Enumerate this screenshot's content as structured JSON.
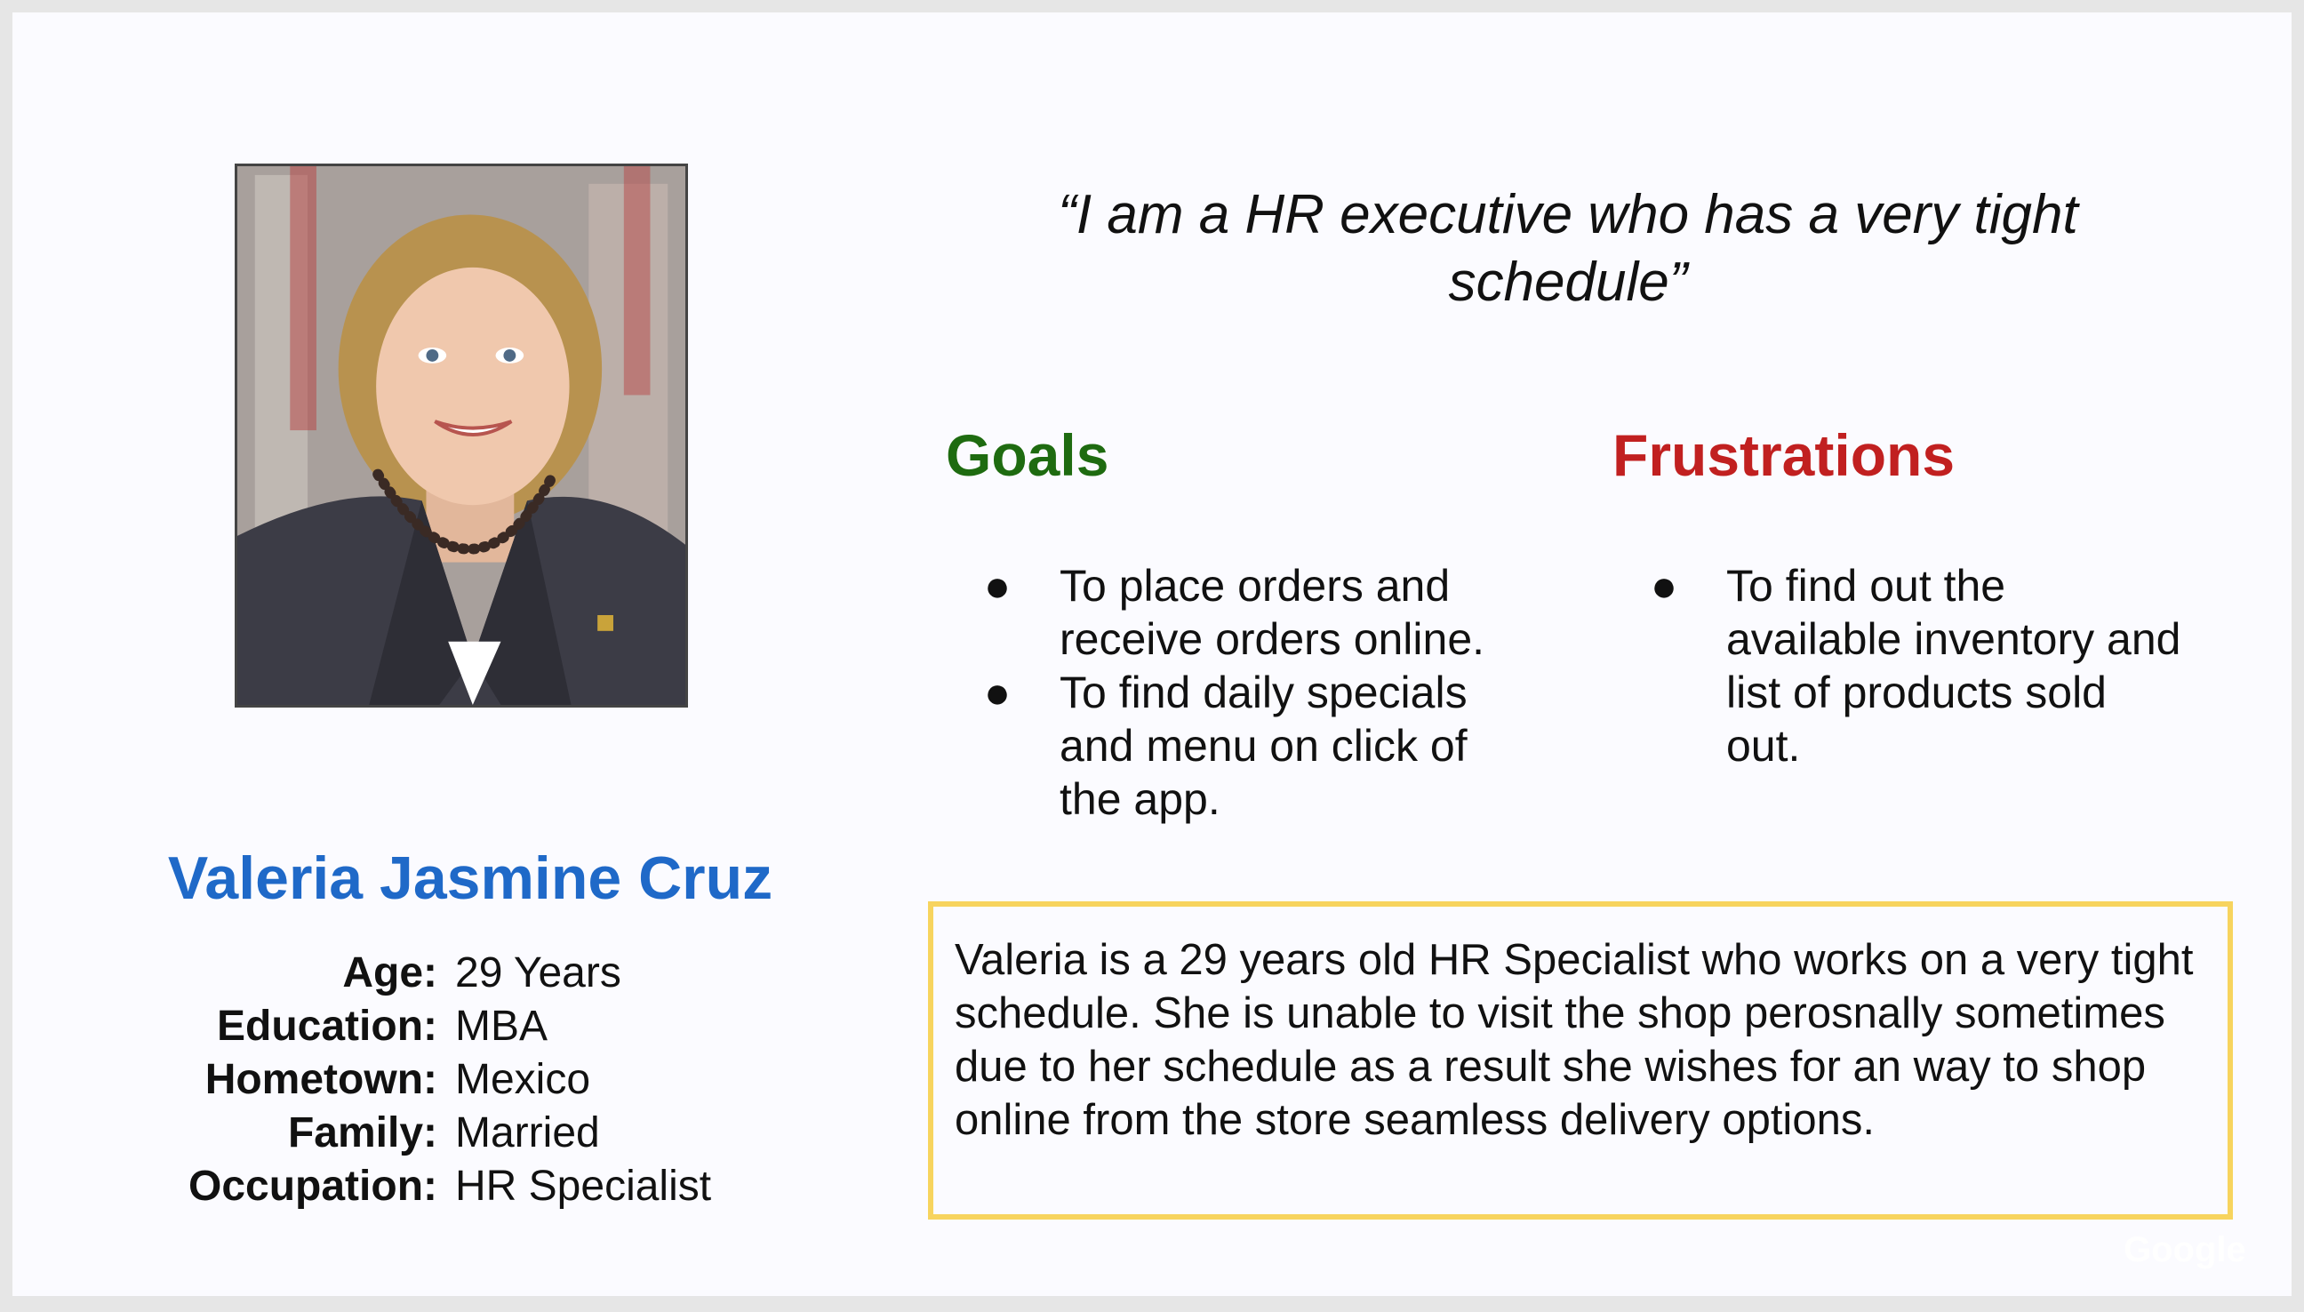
{
  "persona": {
    "name": "Valeria Jasmine Cruz",
    "details": [
      {
        "label": "Age:",
        "value": "29 Years"
      },
      {
        "label": "Education:",
        "value": "MBA"
      },
      {
        "label": "Hometown:",
        "value": "Mexico"
      },
      {
        "label": "Family:",
        "value": "Married"
      },
      {
        "label": "Occupation:",
        "value": "HR Specialist"
      }
    ]
  },
  "quote": "“I am a HR executive who has a very tight schedule”",
  "goals": {
    "heading": "Goals",
    "items": [
      "To place orders and receive orders online.",
      "To find daily specials and menu on click of the app."
    ]
  },
  "frustrations": {
    "heading": "Frustrations",
    "items": [
      "To find out the available inventory and list of products sold out."
    ]
  },
  "bio": "Valeria is a 29 years old HR Specialist who works on a very tight schedule. She is unable to visit the shop perosnally sometimes due to her schedule as a result she wishes for an way to shop online from the store seamless delivery options.",
  "watermark": "Google",
  "colors": {
    "name": "#1f69c8",
    "goals": "#1e6b10",
    "frustrations": "#c12020",
    "bio_border": "#f7d45e"
  }
}
